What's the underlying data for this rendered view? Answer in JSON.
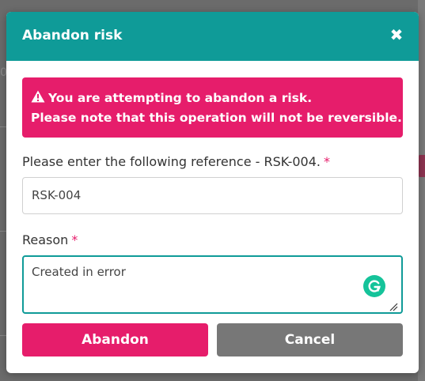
{
  "modal": {
    "title": "Abandon risk",
    "close_icon": "close-icon",
    "alert": {
      "icon": "warning-icon",
      "line1": "You are attempting to abandon a risk.",
      "line2": "Please note that this operation will not be reversible."
    },
    "reference_field": {
      "label": "Please enter the following reference - RSK-004.",
      "required_marker": "*",
      "value": "RSK-004"
    },
    "reason_field": {
      "label": "Reason",
      "required_marker": "*",
      "value": "Created in error"
    },
    "buttons": {
      "abandon_label": "Abandon",
      "cancel_label": "Cancel"
    }
  },
  "background": {
    "left_fragment": "0"
  },
  "colors": {
    "header": "#0f9b98",
    "accent": "#e61d6b",
    "cancel": "#777777",
    "grammarly": "#15c39a"
  }
}
